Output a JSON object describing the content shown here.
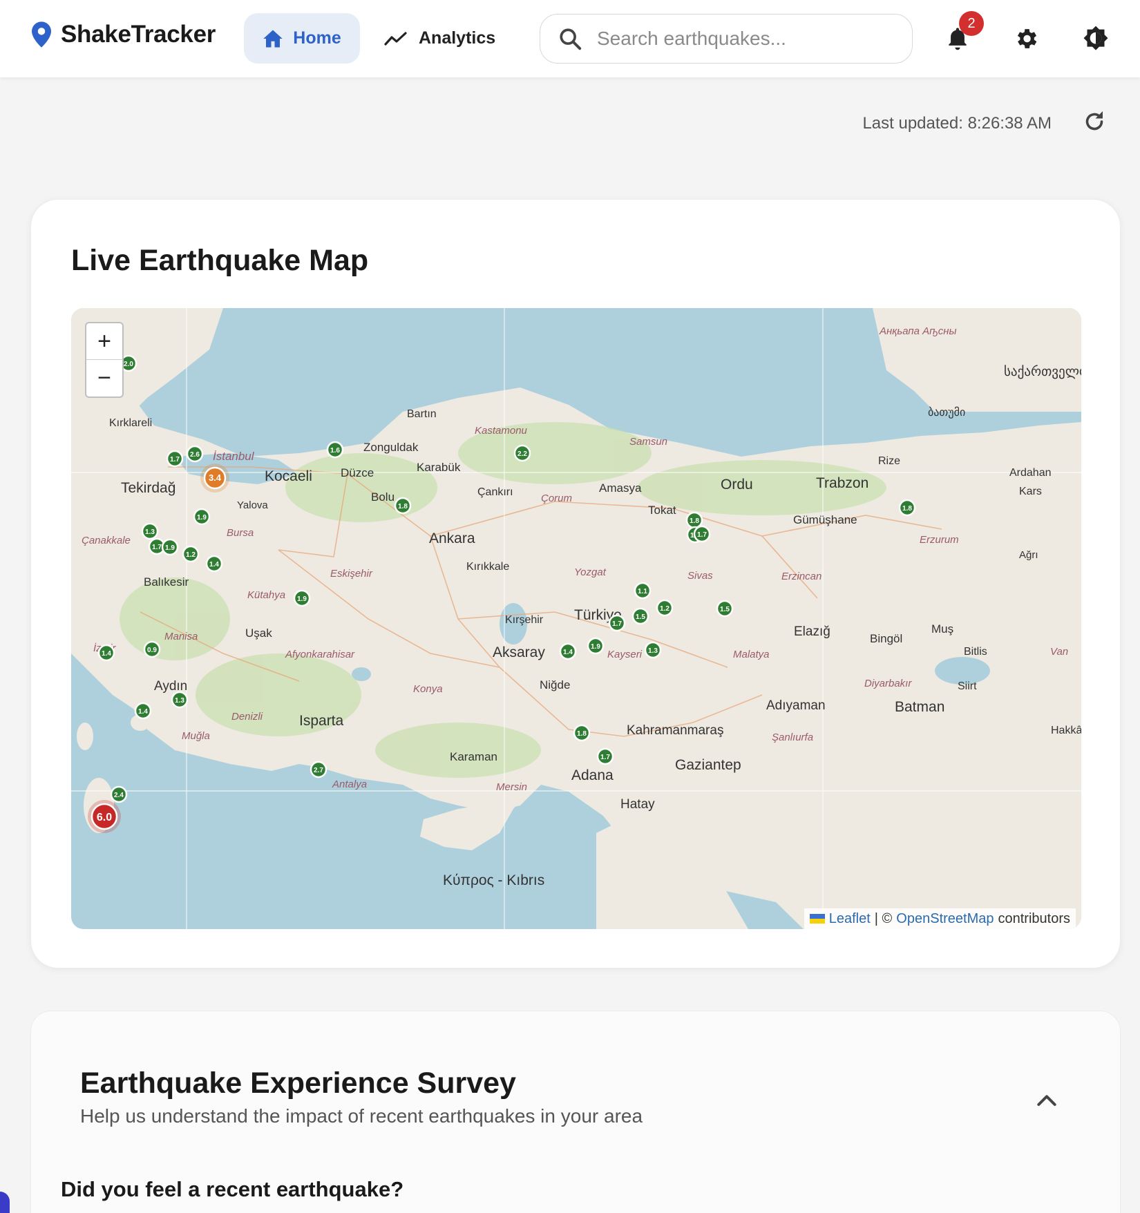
{
  "app": {
    "name": "ShakeTracker"
  },
  "nav": {
    "home": "Home",
    "analytics": "Analytics"
  },
  "search": {
    "placeholder": "Search earthquakes..."
  },
  "notifications": {
    "count": "2"
  },
  "status": {
    "last_updated": "Last updated: 8:26:38 AM"
  },
  "map_card": {
    "title": "Live Earthquake Map",
    "zoom_in": "+",
    "zoom_out": "−",
    "attribution": {
      "leaflet": "Leaflet",
      "sep": "| ©",
      "osm": "OpenStreetMap",
      "suffix": "contributors"
    },
    "labels": [
      {
        "text": "Kırklareli"
      },
      {
        "text": "Tekirdağ"
      },
      {
        "text": "İstanbul"
      },
      {
        "text": "Kocaeli"
      },
      {
        "text": "Yalova"
      },
      {
        "text": "Bursa"
      },
      {
        "text": "Çanakkale"
      },
      {
        "text": "Balıkesir"
      },
      {
        "text": "Manisa"
      },
      {
        "text": "İzmir"
      },
      {
        "text": "Aydın"
      },
      {
        "text": "Muğla"
      },
      {
        "text": "Denizli"
      },
      {
        "text": "Uşak"
      },
      {
        "text": "Kütahya"
      },
      {
        "text": "Eskişehir"
      },
      {
        "text": "Afyonkarahisar"
      },
      {
        "text": "Isparta"
      },
      {
        "text": "Antalya"
      },
      {
        "text": "Konya"
      },
      {
        "text": "Karaman"
      },
      {
        "text": "Mersin"
      },
      {
        "text": "Adana"
      },
      {
        "text": "Niğde"
      },
      {
        "text": "Aksaray"
      },
      {
        "text": "Kırşehir"
      },
      {
        "text": "Kırıkkale"
      },
      {
        "text": "Ankara"
      },
      {
        "text": "Bolu"
      },
      {
        "text": "Düzce"
      },
      {
        "text": "Zonguldak"
      },
      {
        "text": "Karabük"
      },
      {
        "text": "Bartın"
      },
      {
        "text": "Kastamonu"
      },
      {
        "text": "Çankırı"
      },
      {
        "text": "Çorum"
      },
      {
        "text": "Samsun"
      },
      {
        "text": "Amasya"
      },
      {
        "text": "Tokat"
      },
      {
        "text": "Ordu"
      },
      {
        "text": "Trabzon"
      },
      {
        "text": "Rize"
      },
      {
        "text": "Gümüşhane"
      },
      {
        "text": "Erzincan"
      },
      {
        "text": "Erzurum"
      },
      {
        "text": "Ardahan"
      },
      {
        "text": "Kars"
      },
      {
        "text": "Ağrı"
      },
      {
        "text": "Sivas"
      },
      {
        "text": "Yozgat"
      },
      {
        "text": "Türkiye"
      },
      {
        "text": "Kayseri"
      },
      {
        "text": "Malatya"
      },
      {
        "text": "Elazığ"
      },
      {
        "text": "Bingöl"
      },
      {
        "text": "Muş"
      },
      {
        "text": "Bitlis"
      },
      {
        "text": "Van"
      },
      {
        "text": "Siirt"
      },
      {
        "text": "Batman"
      },
      {
        "text": "Diyarbakır"
      },
      {
        "text": "Adıyaman"
      },
      {
        "text": "Kahramanmaraş"
      },
      {
        "text": "Gaziantep"
      },
      {
        "text": "Şanlıurfa"
      },
      {
        "text": "Hatay"
      },
      {
        "text": "Κύπρος - Kıbrıs"
      },
      {
        "text": "Hakkâri"
      },
      {
        "text": "ბათუმი"
      },
      {
        "text": "საქართველო"
      },
      {
        "text": "Анқьапа Аҧсны"
      }
    ],
    "quakes": [
      {
        "mag": "2.0",
        "level": "low"
      },
      {
        "mag": "2.6",
        "level": "low"
      },
      {
        "mag": "1.7",
        "level": "low"
      },
      {
        "mag": "3.4",
        "level": "mid"
      },
      {
        "mag": "1.9",
        "level": "low"
      },
      {
        "mag": "1.3",
        "level": "low"
      },
      {
        "mag": "1.7",
        "level": "low"
      },
      {
        "mag": "1.9",
        "level": "low"
      },
      {
        "mag": "1.2",
        "level": "low"
      },
      {
        "mag": "1.4",
        "level": "low"
      },
      {
        "mag": "1.9",
        "level": "low"
      },
      {
        "mag": "1.4",
        "level": "low"
      },
      {
        "mag": "0.9",
        "level": "low"
      },
      {
        "mag": "1.3",
        "level": "low"
      },
      {
        "mag": "1.4",
        "level": "low"
      },
      {
        "mag": "2.7",
        "level": "low"
      },
      {
        "mag": "2.4",
        "level": "low"
      },
      {
        "mag": "6.0",
        "level": "high"
      },
      {
        "mag": "1.6",
        "level": "low"
      },
      {
        "mag": "1.8",
        "level": "low"
      },
      {
        "mag": "2.2",
        "level": "low"
      },
      {
        "mag": "1.4",
        "level": "low"
      },
      {
        "mag": "1.8",
        "level": "low"
      },
      {
        "mag": "1.7",
        "level": "low"
      },
      {
        "mag": "1.8",
        "level": "low"
      },
      {
        "mag": "1.1",
        "level": "low"
      },
      {
        "mag": "1.2",
        "level": "low"
      },
      {
        "mag": "1.5",
        "level": "low"
      },
      {
        "mag": "1.7",
        "level": "low"
      },
      {
        "mag": "1.5",
        "level": "low"
      },
      {
        "mag": "1.9",
        "level": "low"
      },
      {
        "mag": "1.4",
        "level": "low"
      },
      {
        "mag": "1.3",
        "level": "low"
      },
      {
        "mag": "1.8",
        "level": "low"
      },
      {
        "mag": "1.7",
        "level": "low"
      },
      {
        "mag": "1.8",
        "level": "low"
      }
    ]
  },
  "survey": {
    "title": "Earthquake Experience Survey",
    "subtitle": "Help us understand the impact of recent earthquakes in your area",
    "question": "Did you feel a recent earthquake?"
  },
  "colors": {
    "accent": "#2d63c8",
    "low": "#2e7d32",
    "mid": "#e07b27",
    "high": "#c62828",
    "sea": "#aed0dd",
    "land": "#eeeae1"
  },
  "icons": {
    "brand": "map-pin-icon",
    "home": "home-icon",
    "analytics": "trend-line-icon",
    "search": "search-icon",
    "notifications": "bell-icon",
    "settings": "gear-icon",
    "theme": "contrast-icon",
    "refresh": "refresh-icon",
    "collapse": "chevron-up-icon"
  }
}
